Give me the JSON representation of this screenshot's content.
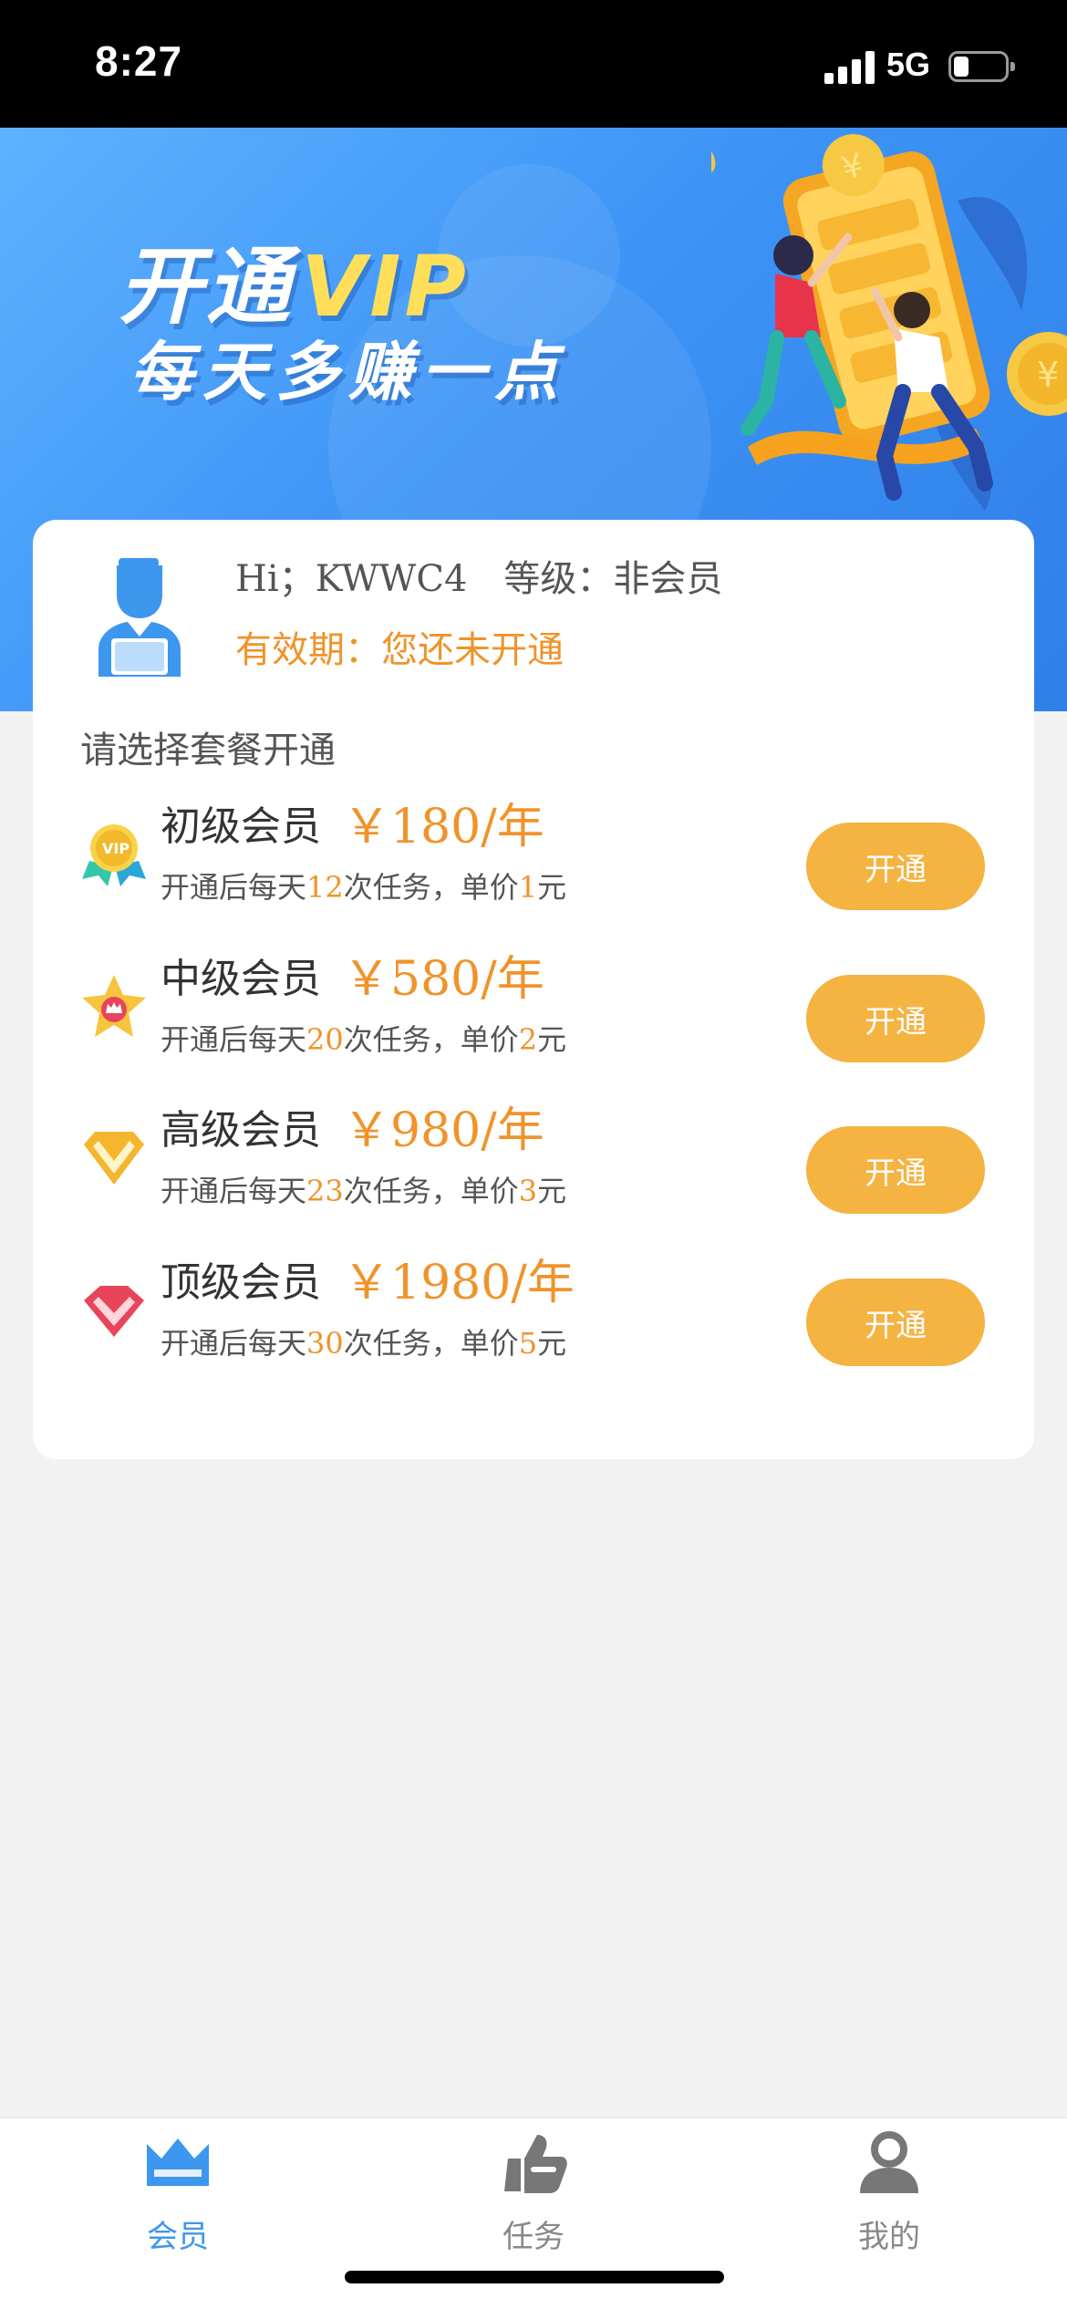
{
  "status_bar": {
    "time": "8:27",
    "network": "5G",
    "battery_level": 0.3
  },
  "banner": {
    "title_main": "开通",
    "title_vip": "VIP",
    "subtitle": "每天多赚一点"
  },
  "user": {
    "greeting": "Hi；KWWC4",
    "level": "等级：非会员",
    "validity": "有效期：您还未开通"
  },
  "packages_title": "请选择套餐开通",
  "packages": [
    {
      "name": "初级会员",
      "price": "￥180/年",
      "desc_prefix": "开通后每天",
      "tasks": "12",
      "desc_mid": "次任务，单价",
      "unit_price": "1",
      "desc_suffix": "元",
      "button": "开通",
      "icon": "vip-medal-icon"
    },
    {
      "name": "中级会员",
      "price": "￥580/年",
      "desc_prefix": "开通后每天",
      "tasks": "20",
      "desc_mid": "次任务，单价",
      "unit_price": "2",
      "desc_suffix": "元",
      "button": "开通",
      "icon": "star-crown-icon"
    },
    {
      "name": "高级会员",
      "price": "￥980/年",
      "desc_prefix": "开通后每天",
      "tasks": "23",
      "desc_mid": "次任务，单价",
      "unit_price": "3",
      "desc_suffix": "元",
      "button": "开通",
      "icon": "gold-diamond-icon"
    },
    {
      "name": "顶级会员",
      "price": "￥1980/年",
      "desc_prefix": "开通后每天",
      "tasks": "30",
      "desc_mid": "次任务，单价",
      "unit_price": "5",
      "desc_suffix": "元",
      "button": "开通",
      "icon": "red-diamond-icon"
    }
  ],
  "tabs": [
    {
      "label": "会员",
      "icon": "crown-icon",
      "active": true
    },
    {
      "label": "任务",
      "icon": "thumbs-up-icon",
      "active": false
    },
    {
      "label": "我的",
      "icon": "person-icon",
      "active": false
    }
  ],
  "colors": {
    "accent_orange": "#f0932a",
    "button_orange": "#f5b342",
    "banner_blue": "#3e95f6",
    "tab_active": "#3d97ef"
  }
}
